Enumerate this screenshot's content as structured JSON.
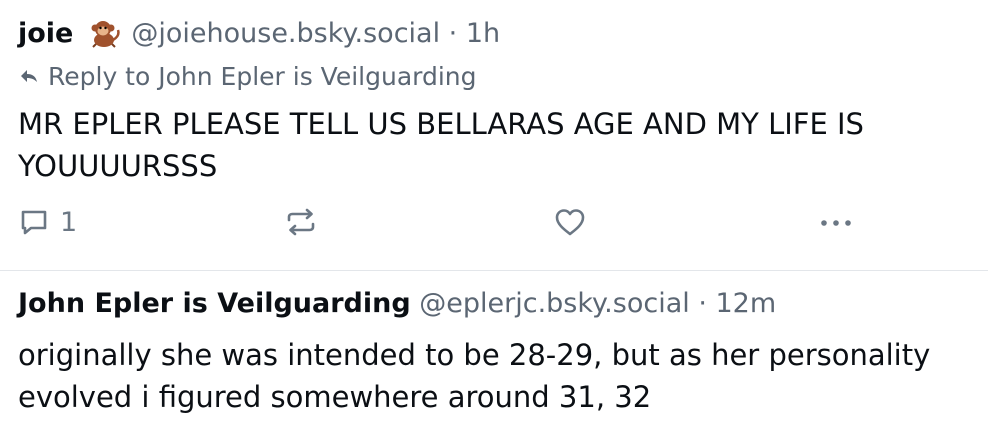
{
  "post1": {
    "author": "joie",
    "emoji": "monkey-emoji",
    "handle": "@joiehouse.bsky.social · 1h",
    "reply_to": "Reply to John Epler is Veilguarding",
    "text": "MR EPLER PLEASE TELL US BELLARAS AGE AND MY LIFE IS\nYOUUUURSSS",
    "actions": {
      "reply_icon": "reply-bubble-icon",
      "reply_count": "1",
      "repost_icon": "repost-icon",
      "like_icon": "heart-icon",
      "more_icon": "more-dots-icon"
    }
  },
  "post2": {
    "author": "John Epler is Veilguarding",
    "handle": "@eplerjc.bsky.social · 12m",
    "text": "originally she was intended to be 28-29, but as her personality\nevolved i figured somewhere around 31, 32"
  },
  "colors": {
    "text": "#0b0f14",
    "muted": "#5b6673",
    "icon": "#6b7784",
    "divider": "#e3e6ea"
  }
}
